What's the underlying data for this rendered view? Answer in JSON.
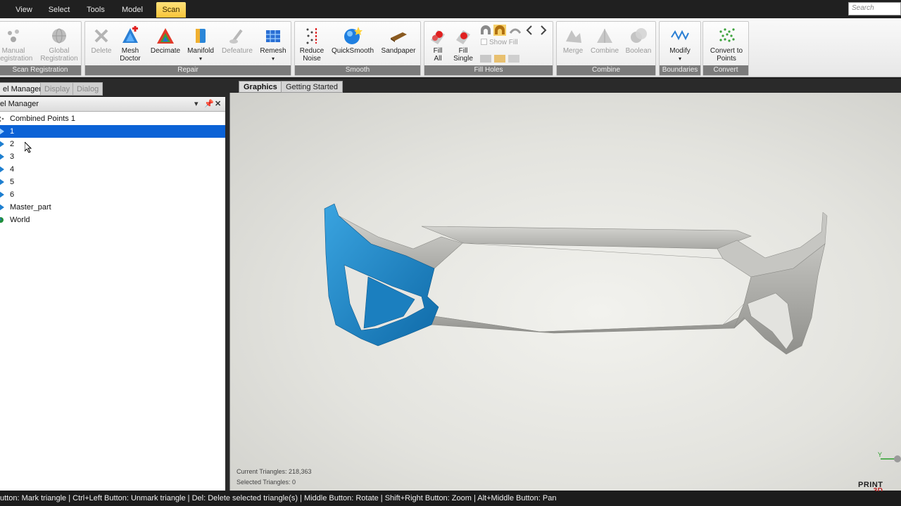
{
  "menubar": {
    "items": [
      "View",
      "Select",
      "Tools",
      "Model",
      "Scan"
    ],
    "active": "Scan",
    "search_placeholder": "Search"
  },
  "ribbon": {
    "groups": {
      "scan_registration": {
        "label": "Scan Registration",
        "buttons": [
          {
            "line1": "Manual",
            "line2": "Registration",
            "icon": "manual-registration-icon"
          },
          {
            "line1": "Global",
            "line2": "Registration",
            "icon": "global-registration-icon"
          }
        ]
      },
      "repair": {
        "label": "Repair",
        "buttons": [
          {
            "line1": "Delete",
            "line2": "",
            "icon": "delete-icon"
          },
          {
            "line1": "Mesh",
            "line2": "Doctor",
            "icon": "mesh-doctor-icon"
          },
          {
            "line1": "Decimate",
            "line2": "",
            "icon": "decimate-icon"
          },
          {
            "line1": "Manifold",
            "line2": "",
            "icon": "manifold-icon"
          },
          {
            "line1": "Defeature",
            "line2": "",
            "icon": "defeature-icon"
          },
          {
            "line1": "Remesh",
            "line2": "",
            "icon": "remesh-icon"
          }
        ]
      },
      "smooth": {
        "label": "Smooth",
        "buttons": [
          {
            "line1": "Reduce",
            "line2": "Noise",
            "icon": "reduce-noise-icon"
          },
          {
            "line1": "QuickSmooth",
            "line2": "",
            "icon": "quicksmooth-icon"
          },
          {
            "line1": "Sandpaper",
            "line2": "",
            "icon": "sandpaper-icon"
          }
        ]
      },
      "fill_holes": {
        "label": "Fill Holes",
        "buttons": [
          {
            "line1": "Fill",
            "line2": "All",
            "icon": "fill-all-icon"
          },
          {
            "line1": "Fill",
            "line2": "Single",
            "icon": "fill-single-icon"
          }
        ],
        "show_fill": "Show Fill"
      },
      "combine": {
        "label": "Combine",
        "buttons": [
          {
            "line1": "Merge",
            "line2": "",
            "icon": "merge-icon"
          },
          {
            "line1": "Combine",
            "line2": "",
            "icon": "combine-icon"
          },
          {
            "line1": "Boolean",
            "line2": "",
            "icon": "boolean-icon"
          }
        ]
      },
      "boundaries": {
        "label": "Boundaries",
        "buttons": [
          {
            "line1": "Modify",
            "line2": "",
            "icon": "modify-icon"
          }
        ]
      },
      "convert": {
        "label": "Convert",
        "buttons": [
          {
            "line1": "Convert to",
            "line2": "Points",
            "icon": "convert-to-points-icon"
          }
        ]
      }
    }
  },
  "left_panel": {
    "tabs": [
      "el Manager",
      "Display",
      "Dialog"
    ],
    "header_title": "el Manager",
    "tree": [
      {
        "label": "Combined Points 1",
        "icon": "points-icon",
        "selected": false
      },
      {
        "label": "1",
        "icon": "mesh-icon",
        "selected": true
      },
      {
        "label": "2",
        "icon": "mesh-icon",
        "selected": false
      },
      {
        "label": "3",
        "icon": "mesh-icon",
        "selected": false
      },
      {
        "label": "4",
        "icon": "mesh-icon",
        "selected": false
      },
      {
        "label": "5",
        "icon": "mesh-icon",
        "selected": false
      },
      {
        "label": "6",
        "icon": "mesh-icon",
        "selected": false
      },
      {
        "label": "Master_part",
        "icon": "mesh-icon",
        "selected": false
      },
      {
        "label": "World",
        "icon": "world-icon",
        "selected": false
      }
    ]
  },
  "graphics": {
    "tabs": [
      "Graphics",
      "Getting Started"
    ],
    "active_tab": "Graphics",
    "current_triangles": "Current Triangles: 218,363",
    "selected_triangles": "Selected Triangles: 0",
    "axis_label": "Y",
    "logo_text": "PRINT",
    "logo_sub": "3D"
  },
  "statusbar": {
    "text": "utton: Mark triangle | Ctrl+Left Button: Unmark triangle | Del: Delete selected triangle(s) | Middle Button: Rotate | Shift+Right Button: Zoom | Alt+Middle Button: Pan"
  },
  "colors": {
    "selection_blue": "#0b62d6",
    "scan_tab": "#f8c43a",
    "highlight_mesh": "#1e8ccc",
    "mesh_gray": "#b8b8b4"
  }
}
